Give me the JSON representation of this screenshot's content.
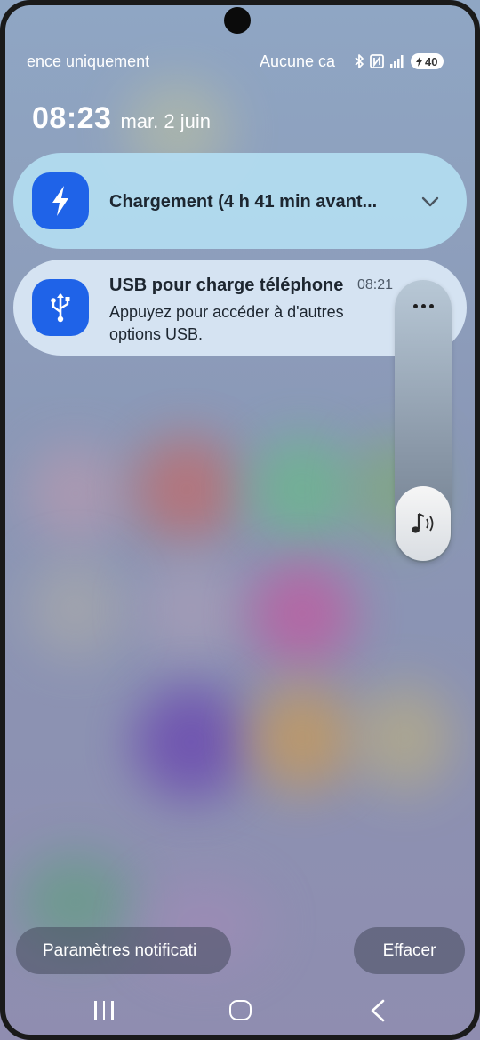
{
  "status_bar": {
    "left_text": "ence uniquement",
    "carrier_text": "Aucune ca",
    "icons": [
      "bluetooth-icon",
      "nfc-icon",
      "signal-icon",
      "battery-charging-icon"
    ],
    "battery_level": "40"
  },
  "clock": {
    "time": "08:23",
    "date": "mar. 2 juin"
  },
  "notifications": [
    {
      "icon": "lightning-icon",
      "title": "Chargement (4 h 41 min avant...",
      "expand_icon": "chevron-down-icon"
    },
    {
      "icon": "usb-icon",
      "title": "USB pour charge téléphone",
      "time": "08:21",
      "body": "Appuyez pour accéder à d'autres options USB."
    }
  ],
  "volume_panel": {
    "more_icon": "more-horizontal-icon",
    "mode_icon": "music-volume-icon"
  },
  "buttons": {
    "settings_label": "Paramètres notificati",
    "clear_label": "Effacer"
  },
  "nav_bar": {
    "recents_icon": "recents-icon",
    "home_icon": "home-icon",
    "back_icon": "back-icon"
  },
  "colors": {
    "accent_blue": "#1f63e8",
    "charge_card_bg": "#b2dcf0",
    "usb_card_bg": "#dae8f5"
  }
}
